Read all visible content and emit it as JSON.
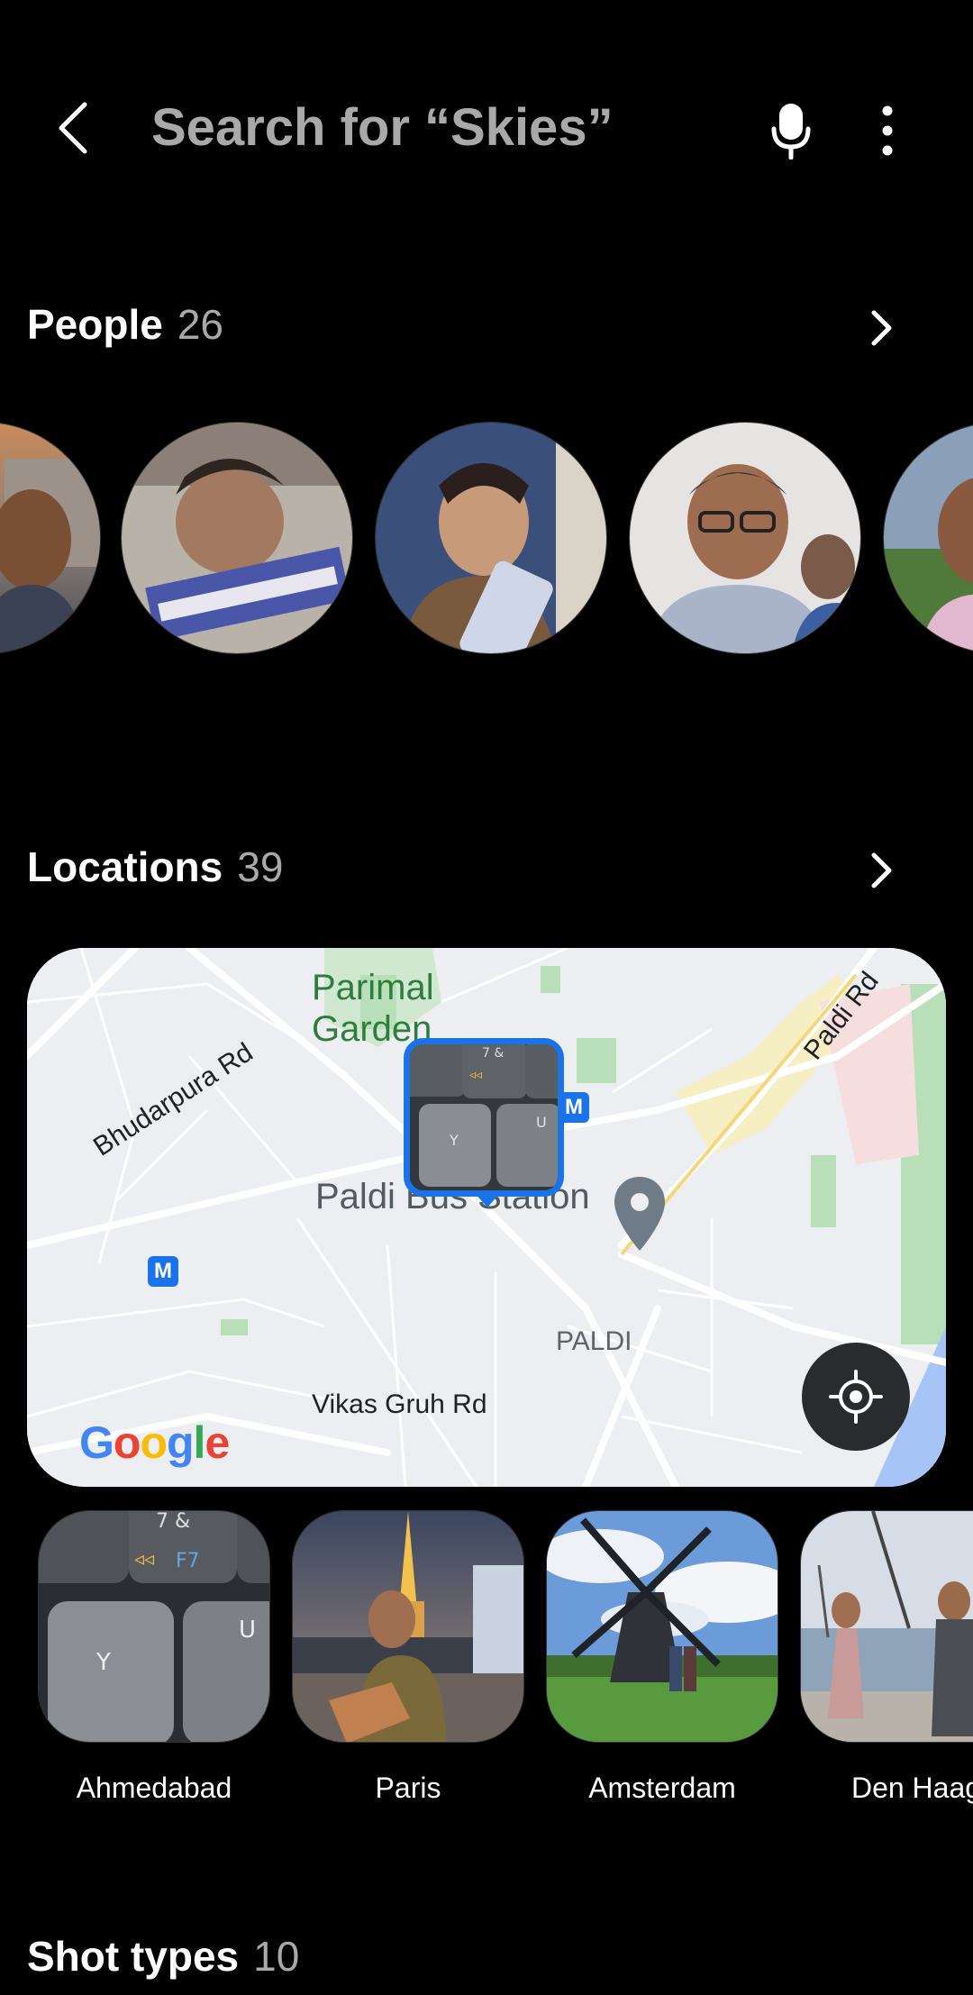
{
  "search": {
    "placeholder": "Search for “Skies”"
  },
  "icons": {
    "back": "back-arrow-icon",
    "mic": "microphone-icon",
    "more": "more-options-icon",
    "chevron": "chevron-right-icon",
    "locate": "my-location-icon",
    "pin": "location-pin-icon"
  },
  "people": {
    "title": "People",
    "count": "26",
    "faces": [
      {
        "name": "person-1"
      },
      {
        "name": "person-2"
      },
      {
        "name": "person-3"
      },
      {
        "name": "person-4"
      },
      {
        "name": "person-5"
      }
    ]
  },
  "locations": {
    "title": "Locations",
    "count": "39",
    "map": {
      "labels": {
        "garden_1": "Parimal",
        "garden_2": "Garden",
        "bhudarpura": "Bhudarpura Rd",
        "paldi_rd": "Paldi Rd",
        "bus_station": "Paldi Bus Station",
        "area": "PALDI",
        "vikas": "Vikas Gruh Rd",
        "metro": "M"
      },
      "attribution": "Google"
    },
    "places": [
      {
        "label": "Ahmedabad"
      },
      {
        "label": "Paris"
      },
      {
        "label": "Amsterdam"
      },
      {
        "label": "Den Haag"
      }
    ]
  },
  "shot_types": {
    "title": "Shot types",
    "count": "10"
  },
  "colors": {
    "background": "#000000",
    "accent_blue": "#1a73e8",
    "muted_text": "#a9a9a9"
  }
}
